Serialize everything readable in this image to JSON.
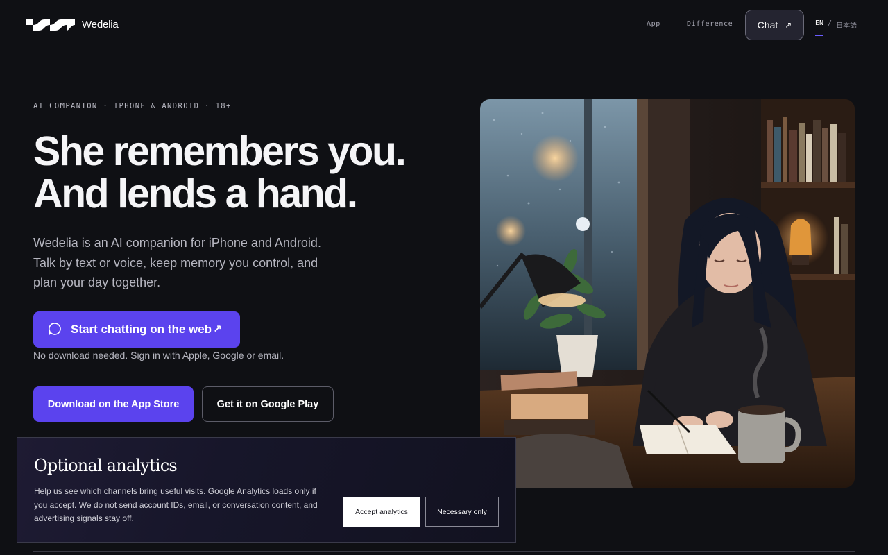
{
  "header": {
    "brand": "Wedelia",
    "nav": [
      "App",
      "Difference"
    ],
    "chat_label": "Chat",
    "chat_arrow": "↗",
    "lang_en": "EN",
    "lang_sep": "/",
    "lang_jp": "日本語"
  },
  "hero": {
    "eyebrow": "AI COMPANION · IPHONE & ANDROID · 18+",
    "headline_1": "She remembers you.",
    "headline_2": "And lends a hand.",
    "lead": "Wedelia is an AI companion for iPhone and Android. Talk by text or voice, keep memory you control, and plan your day together.",
    "primary_cta": "Start chatting on the web",
    "primary_arrow": "↗",
    "cta_note": "No download needed. Sign in with Apple, Google or email.",
    "appstore": "Download on the App Store",
    "googleplay": "Get it on Google Play"
  },
  "cookie": {
    "title": "Optional analytics",
    "text": "Help us see which channels bring useful visits. Google Analytics loads only if you accept. We do not send account IDs, email, or conversation content, and advertising signals stay off.",
    "accept": "Accept analytics",
    "necessary": "Necessary only"
  },
  "colors": {
    "accent": "#5b43ee",
    "background": "#0f1014"
  },
  "icons": [
    "wedelia-logo-icon",
    "chat-bubble-icon",
    "arrow-up-right-icon"
  ]
}
